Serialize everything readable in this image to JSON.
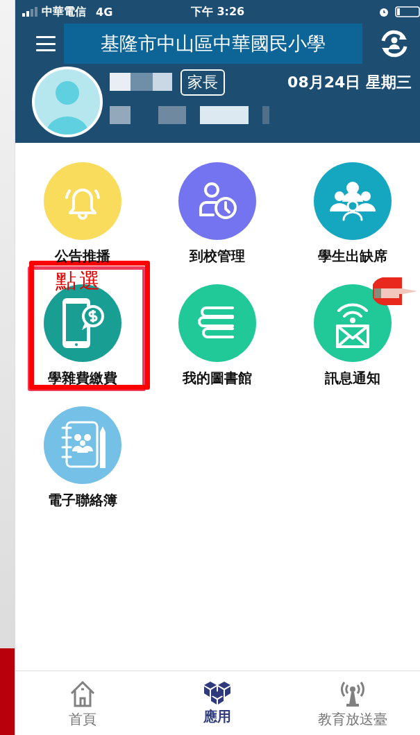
{
  "status_bar": {
    "carrier": "中華電信",
    "network": "4G",
    "time": "下午 3:26"
  },
  "header": {
    "title": "基隆市中山區中華國民小學",
    "role_badge": "家長",
    "date": "08月24日 星期三"
  },
  "apps": [
    {
      "label": "公告推播",
      "color": "#f9dc5c",
      "highlighted": false
    },
    {
      "label": "到校管理",
      "color": "#7474f0",
      "highlighted": false
    },
    {
      "label": "學生出缺席",
      "color": "#16a7c0",
      "highlighted": false
    },
    {
      "label": "學雜費繳費",
      "color": "#189e93",
      "highlighted": true
    },
    {
      "label": "我的圖書館",
      "color": "#20c997",
      "highlighted": false
    },
    {
      "label": "訊息通知",
      "color": "#20c997",
      "highlighted": false
    },
    {
      "label": "電子聯絡簿",
      "color": "#74c0e6",
      "highlighted": false
    }
  ],
  "annotation": {
    "text": "點選"
  },
  "nav": [
    {
      "label": "首頁",
      "selected": false
    },
    {
      "label": "應用",
      "selected": true
    },
    {
      "label": "教育放送臺",
      "selected": false
    }
  ]
}
